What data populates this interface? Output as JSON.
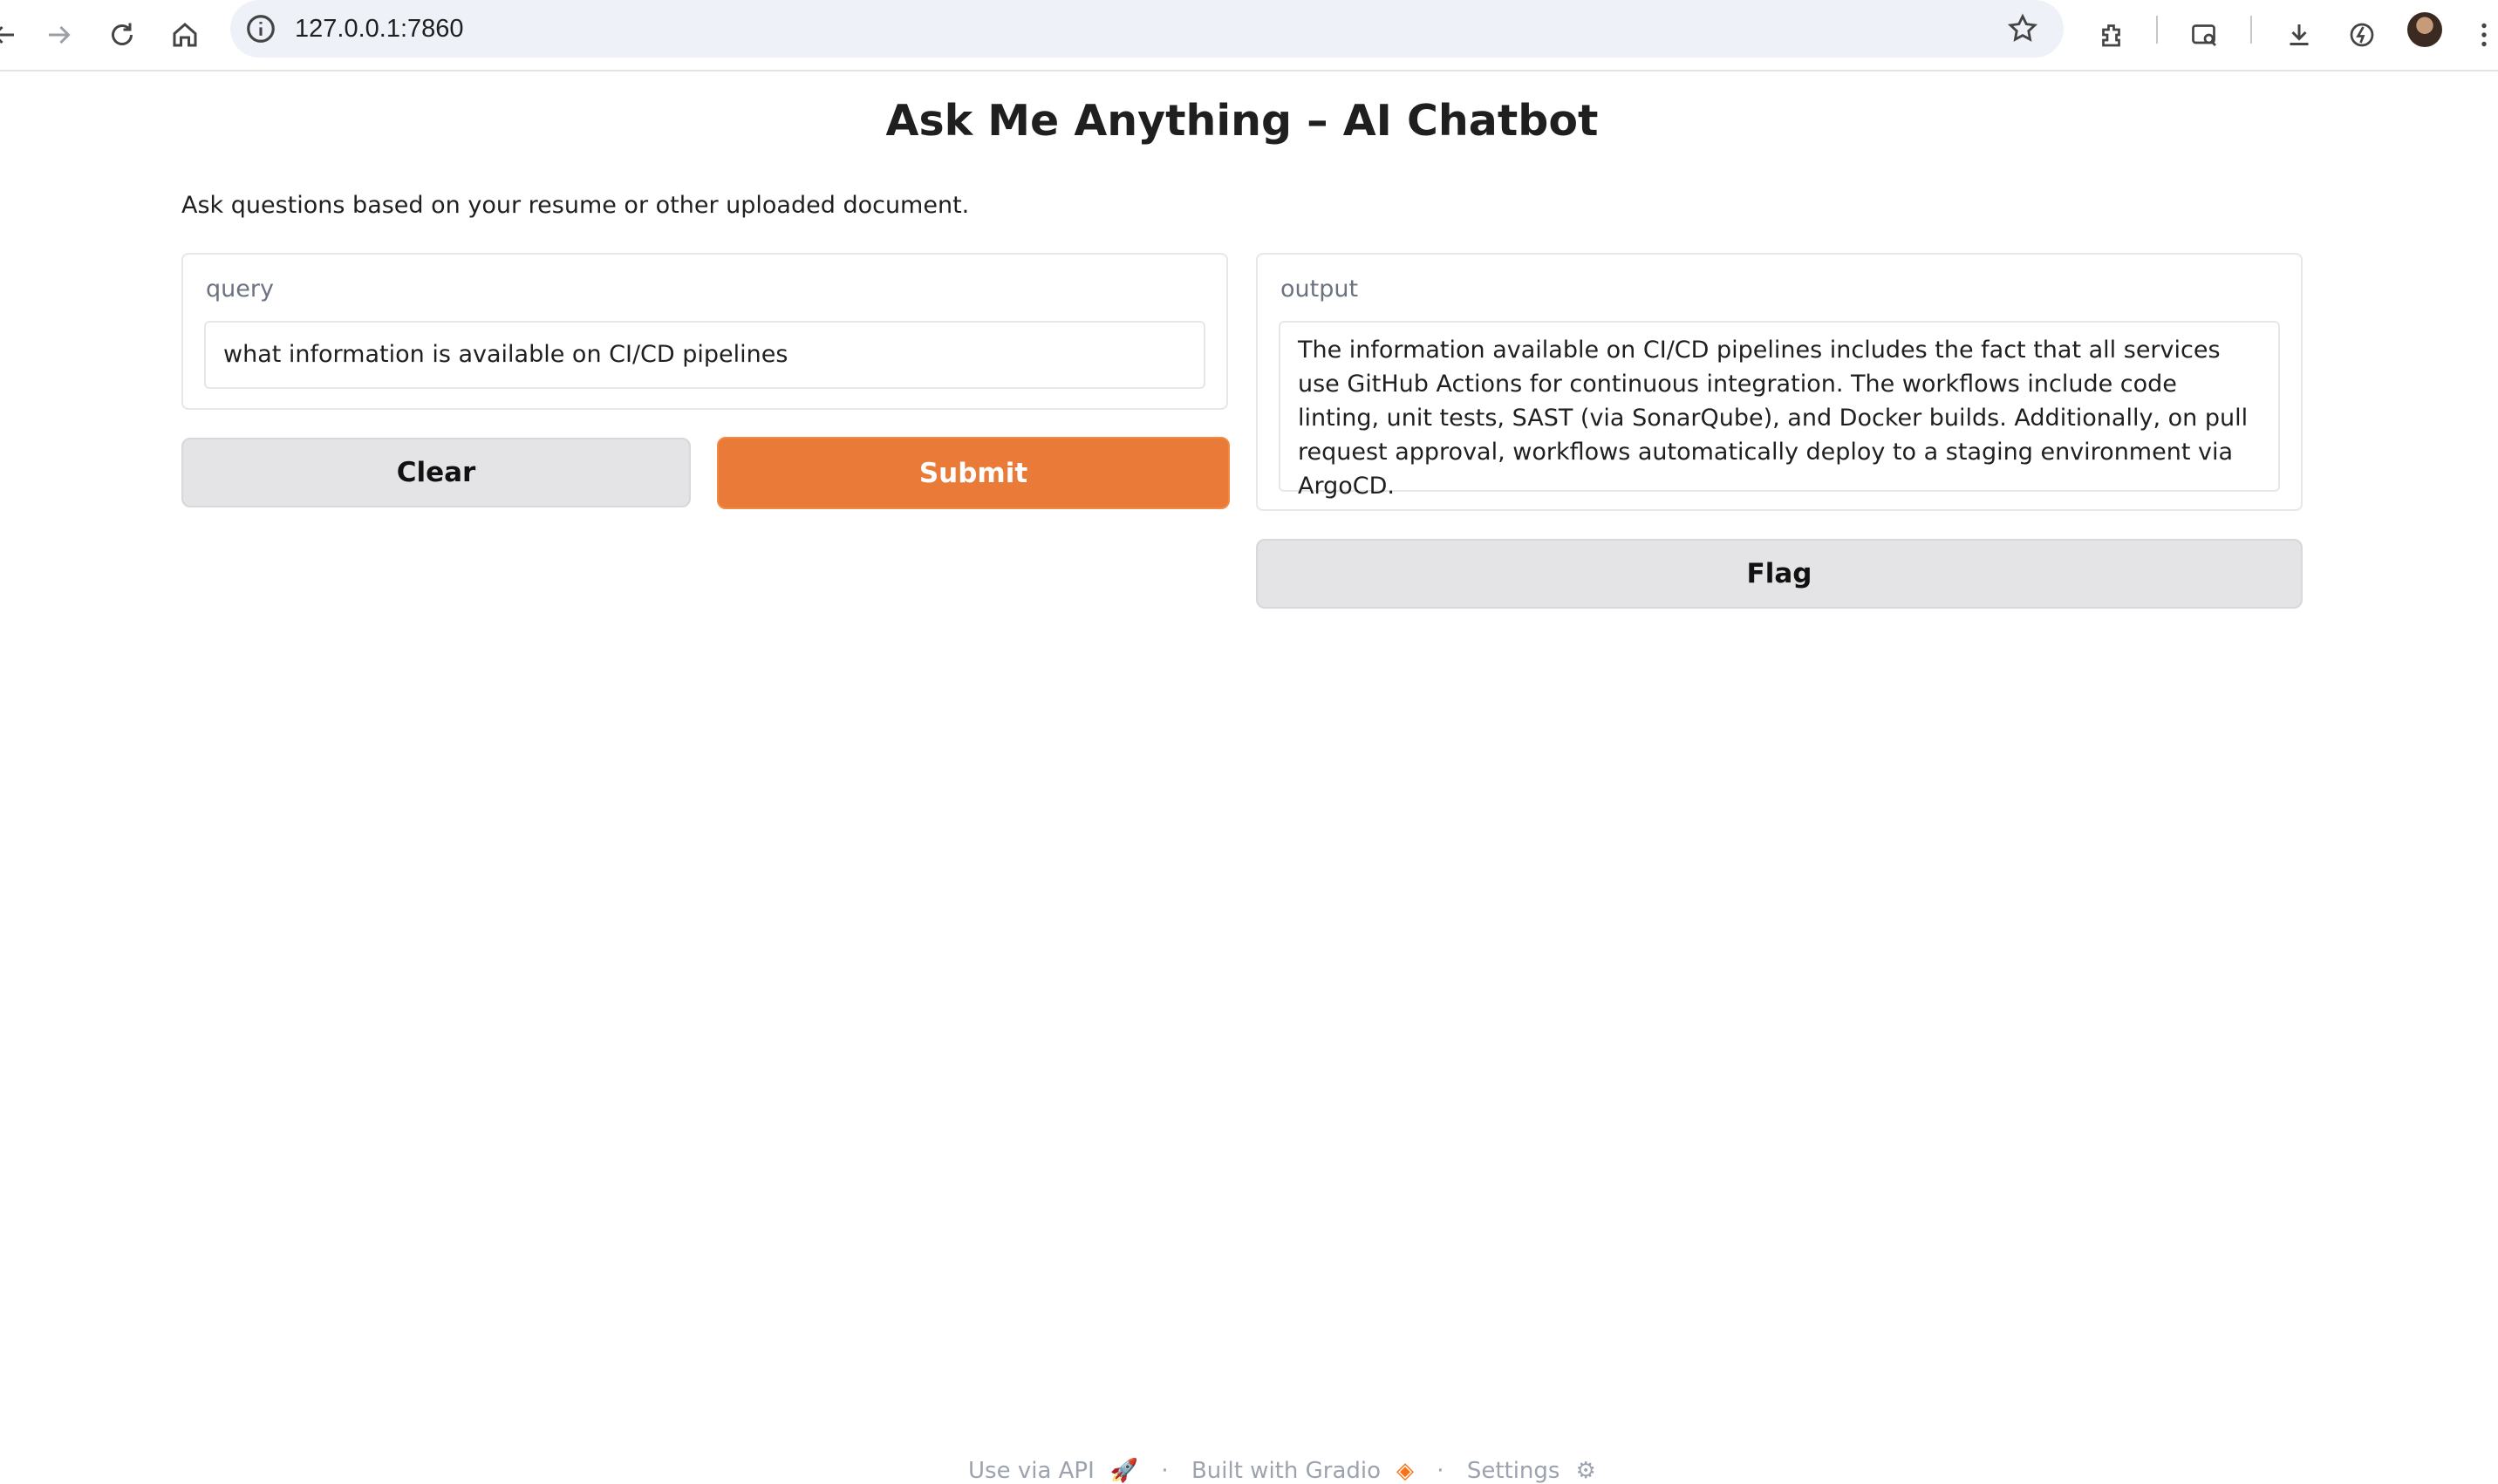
{
  "browser": {
    "url": "127.0.0.1:7860",
    "icons": [
      "back-icon",
      "forward-icon",
      "reload-icon",
      "home-icon",
      "site-info-icon",
      "bookmark-star-icon",
      "extensions-icon",
      "google-lens-icon",
      "download-icon",
      "performance-icon",
      "profile-avatar"
    ]
  },
  "page": {
    "title": "Ask Me Anything – AI Chatbot",
    "description": "Ask questions based on your resume or other uploaded document."
  },
  "input_panel": {
    "label": "query",
    "value": "what information is available on CI/CD pipelines"
  },
  "output_panel": {
    "label": "output",
    "value": "The information available on CI/CD pipelines includes the fact that all services use GitHub Actions for continuous integration. The workflows include code linting, unit tests, SAST (via SonarQube), and Docker builds. Additionally, on pull request approval, workflows automatically deploy to a staging environment via ArgoCD."
  },
  "buttons": {
    "clear": "Clear",
    "submit": "Submit",
    "flag": "Flag"
  },
  "footer": {
    "api": "Use via API",
    "built": "Built with Gradio",
    "settings": "Settings",
    "dot": "·"
  },
  "colors": {
    "primary": "#e97a37",
    "secondary": "#e4e4e7",
    "border": "#e5e7eb"
  }
}
